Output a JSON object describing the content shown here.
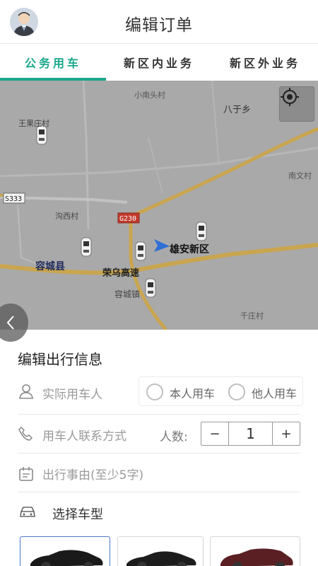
{
  "header": {
    "title": "编辑订单"
  },
  "tabs": [
    {
      "label": "公务用车",
      "active": true
    },
    {
      "label": "新区内业务",
      "active": false
    },
    {
      "label": "新区外业务",
      "active": false
    }
  ],
  "map": {
    "labels": {
      "xiaonan": "小南头村",
      "bazhi": "八于乡",
      "wangjia": "王果庄村",
      "nanwen": "南文村",
      "s333": "S333",
      "gouxi": "沟西村",
      "g230": "G230",
      "xiongan": "雄安新区",
      "rongcheng_xian": "容城县",
      "rongwu": "荣乌高速",
      "rongcheng_zhen": "容城镇",
      "qianzhuang": "千庄村"
    }
  },
  "form": {
    "section_title": "编辑出行信息",
    "passenger_placeholder": "实际用车人",
    "radio_self": "本人用车",
    "radio_other": "他人用车",
    "contact_placeholder": "用车人联系方式",
    "count_label": "人数:",
    "count_minus": "−",
    "count_value": "1",
    "count_plus": "+",
    "reason_placeholder": "出行事由(至少5字)",
    "car_type_label": "选择车型"
  },
  "colors": {
    "accent": "#19a88a",
    "map_bg": "#a9a9a9",
    "road": "#c9a550"
  }
}
